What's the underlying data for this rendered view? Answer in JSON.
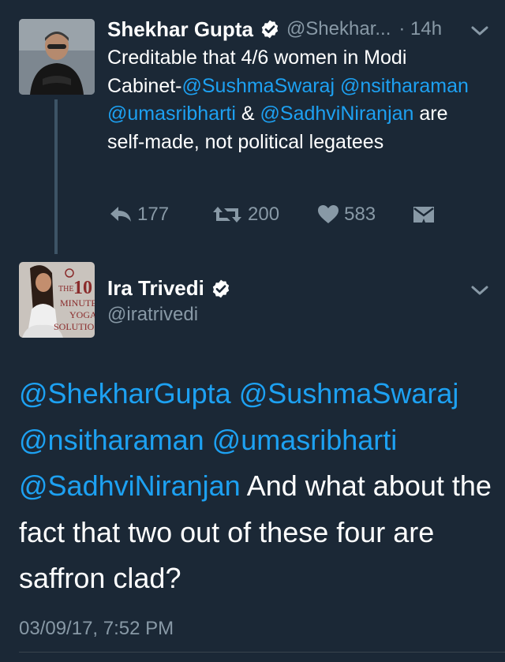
{
  "tweet1": {
    "name": "Shekhar Gupta",
    "handle": "@Shekhar...",
    "time": "· 14h",
    "text_parts": [
      "Creditable that 4/6 women in Modi Cabinet-",
      "@SushmaSwaraj",
      " ",
      "@nsitharaman",
      " ",
      "@umasribharti",
      " & ",
      "@SadhviNiranjan",
      " are self-made, not political legatees"
    ],
    "actions": {
      "reply_count": "177",
      "retweet_count": "200",
      "like_count": "583"
    }
  },
  "tweet2": {
    "name": "Ira Trivedi",
    "handle": "@iratrivedi",
    "avatar_text": {
      "the": "THE",
      "num": "10",
      "minute": "MINUTE",
      "yoga": "YOGA",
      "solution": "SOLUTION"
    },
    "text_parts": [
      "@ShekharGupta",
      " ",
      "@SushmaSwaraj",
      " ",
      "@nsitharaman",
      " ",
      "@umasribharti",
      " ",
      "@SadhviNiranjan",
      " And what about the fact that two out of these four are saffron clad?"
    ],
    "timestamp": "03/09/17, 7:52 PM"
  },
  "colors": {
    "background": "#1b2836",
    "mention": "#1da1f2",
    "muted": "#8899a6",
    "thread_line": "#3d5466"
  },
  "icons": [
    "verified-badge-icon",
    "chevron-down-icon",
    "reply-icon",
    "retweet-icon",
    "heart-icon",
    "direct-message-icon"
  ]
}
